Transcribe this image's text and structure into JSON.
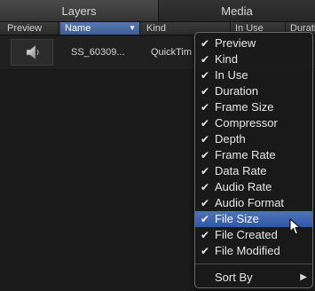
{
  "tabs": [
    {
      "label": "Layers"
    },
    {
      "label": "Media"
    }
  ],
  "columns": {
    "preview": "Preview",
    "name": "Name",
    "kind": "Kind",
    "in_use": "In Use",
    "duration": "Durati"
  },
  "row": {
    "name": "SS_60309...",
    "kind": "QuickTim",
    "icon": "speaker-icon"
  },
  "menu": {
    "items": [
      {
        "label": "Preview",
        "checked": true
      },
      {
        "label": "Kind",
        "checked": true
      },
      {
        "label": "In Use",
        "checked": true
      },
      {
        "label": "Duration",
        "checked": true
      },
      {
        "label": "Frame Size",
        "checked": true
      },
      {
        "label": "Compressor",
        "checked": true
      },
      {
        "label": "Depth",
        "checked": true
      },
      {
        "label": "Frame Rate",
        "checked": true
      },
      {
        "label": "Data Rate",
        "checked": true
      },
      {
        "label": "Audio Rate",
        "checked": true
      },
      {
        "label": "Audio Format",
        "checked": true
      },
      {
        "label": "File Size",
        "checked": true,
        "selected": true
      },
      {
        "label": "File Created",
        "checked": true
      },
      {
        "label": "File Modified",
        "checked": true
      }
    ],
    "check_glyph": "✔",
    "sort_by": "Sort By",
    "submenu_arrow": "▶"
  },
  "colors": {
    "selection": "#3b5ea8",
    "background": "#1c1c1c"
  }
}
